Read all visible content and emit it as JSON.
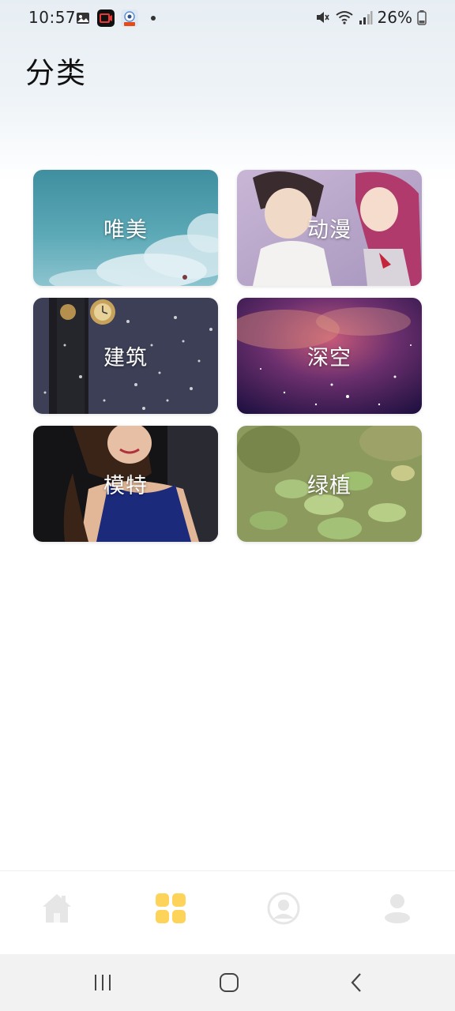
{
  "status_bar": {
    "time": "10:57",
    "battery_percent": "26%",
    "left_icons": [
      "gallery-icon",
      "screen-record-icon",
      "app-notification-icon"
    ],
    "right_icons": [
      "mute-icon",
      "wifi-icon",
      "signal-icon",
      "battery-icon"
    ]
  },
  "header": {
    "title": "分类"
  },
  "categories": [
    {
      "label": "唯美"
    },
    {
      "label": "动漫"
    },
    {
      "label": "建筑"
    },
    {
      "label": "深空"
    },
    {
      "label": "模特"
    },
    {
      "label": "绿植"
    }
  ],
  "bottom_nav": {
    "items": [
      {
        "icon": "home-icon",
        "active": false
      },
      {
        "icon": "category-grid-icon",
        "active": true
      },
      {
        "icon": "profile-circle-icon",
        "active": false
      },
      {
        "icon": "user-icon",
        "active": false
      }
    ],
    "active_color": "#fdd35a",
    "inactive_color": "#e6e6e6"
  },
  "system_nav": {
    "buttons": [
      "recents-button",
      "home-button",
      "back-button"
    ]
  }
}
